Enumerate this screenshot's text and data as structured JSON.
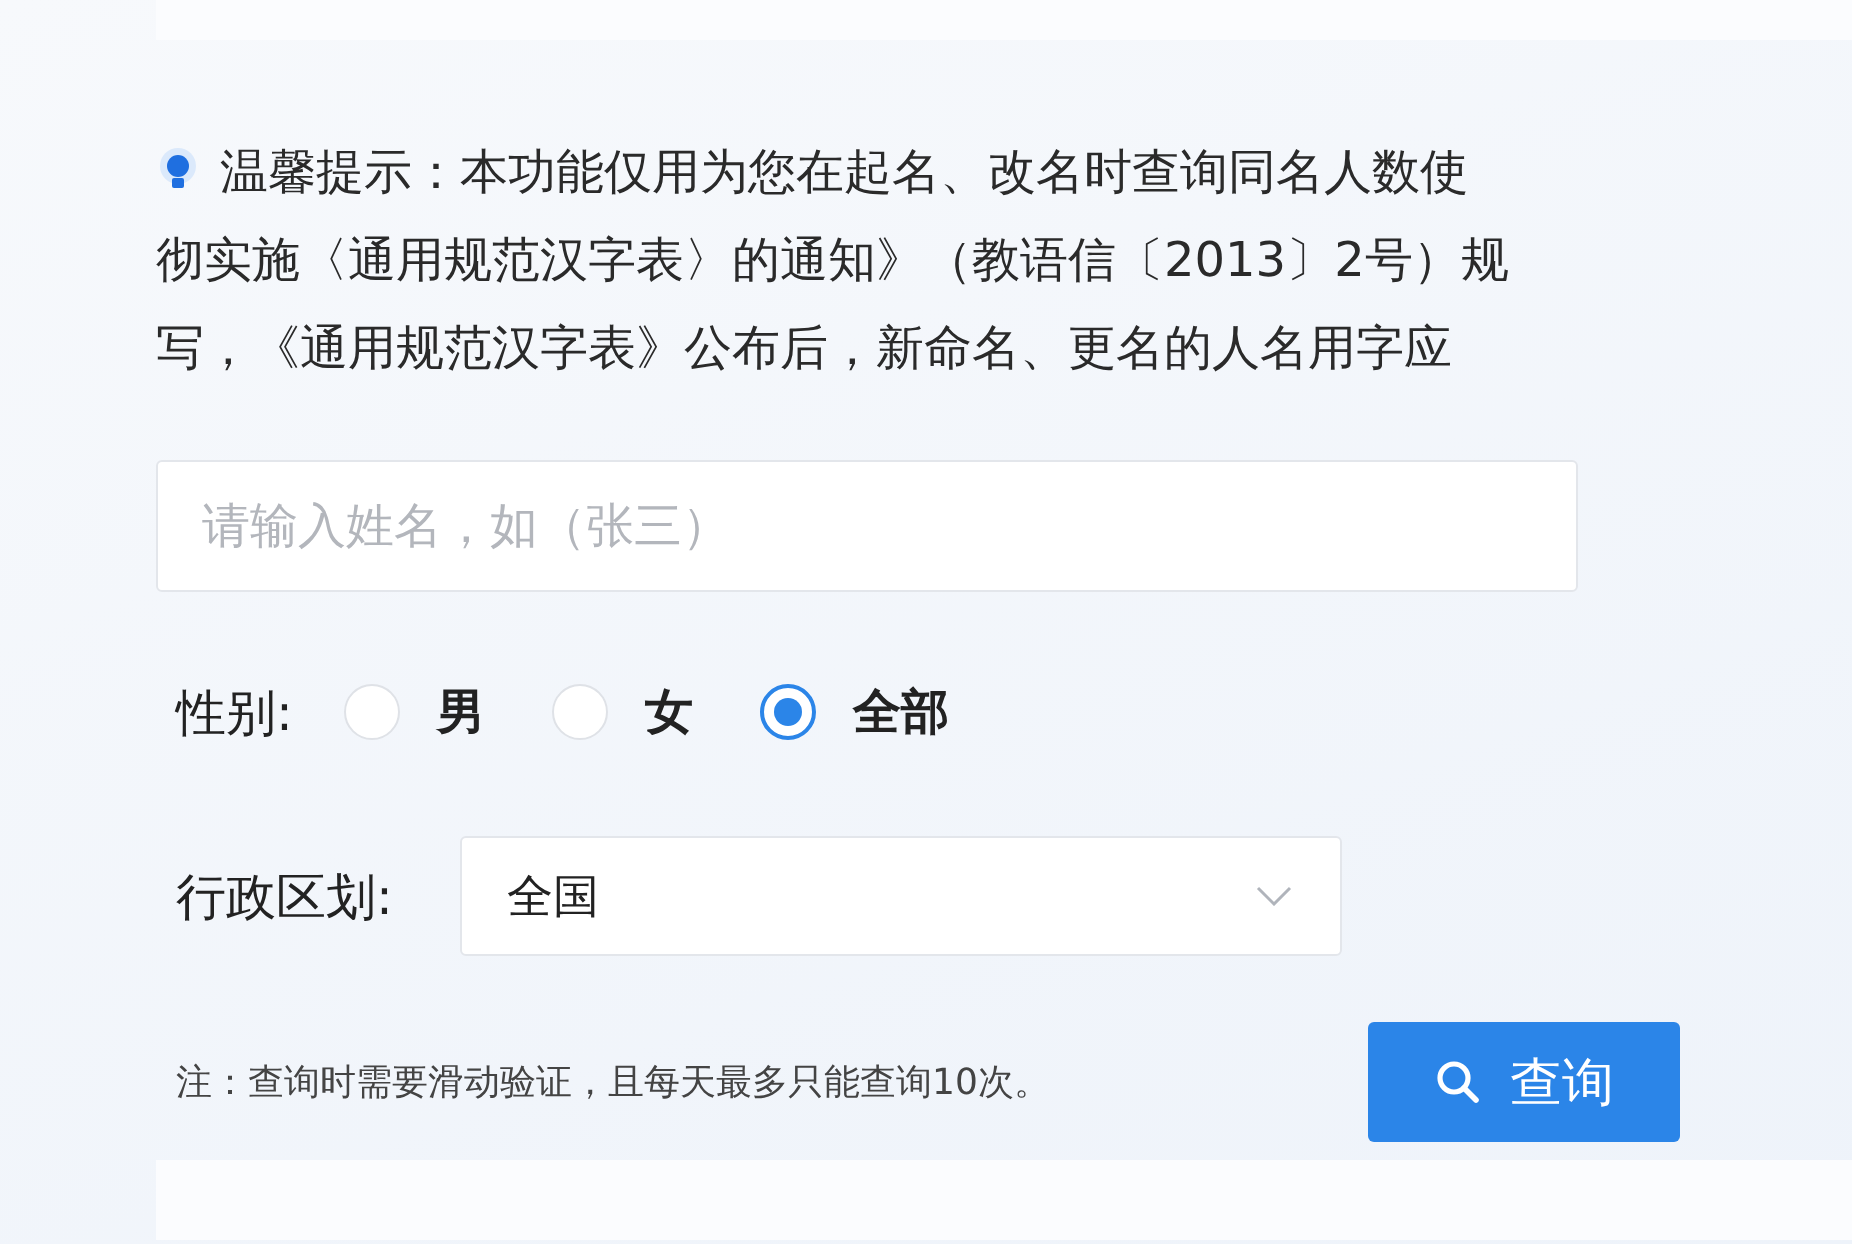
{
  "notice": {
    "lines": [
      "温馨提示：本功能仅用为您在起名、改名时查询同名人数使",
      "彻实施〈通用规范汉字表〉的通知》（教语信〔2013〕2号）规",
      "写，《通用规范汉字表》公布后，新命名、更名的人名用字应"
    ]
  },
  "name_field": {
    "placeholder": "请输入姓名，如（张三）"
  },
  "gender": {
    "label": "性别:",
    "options": [
      {
        "label": "男",
        "selected": false
      },
      {
        "label": "女",
        "selected": false
      },
      {
        "label": "全部",
        "selected": true
      }
    ]
  },
  "region": {
    "label": "行政区划:",
    "value": "全国"
  },
  "note": "注：查询时需要滑动验证，且每天最多只能查询10次。",
  "search_button": {
    "label": "查询"
  }
}
